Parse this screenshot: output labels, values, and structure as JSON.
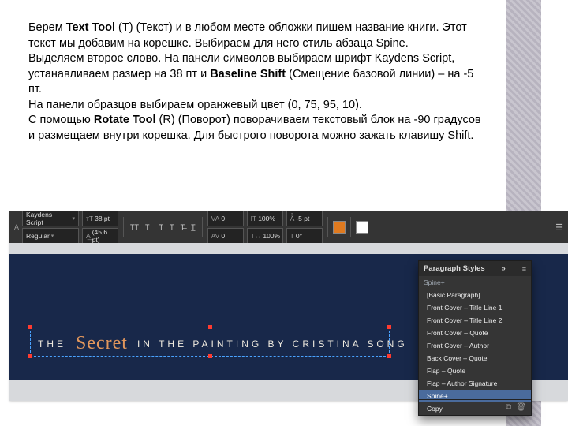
{
  "instruction": {
    "p1a": "Берем ",
    "p1b": "Text Tool",
    "p1c": " (T) (Текст) и в любом месте обложки пишем название книги. Этот текст мы добавим на корешке. Выбираем для него стиль абзаца Spine.",
    "p2a": "Выделяем второе слово. На панели символов выбираем шрифт Kaydens Script, устанавливаем размер на 38 пт и ",
    "p2b": "Baseline Shift",
    "p2c": " (Смещение базовой линии) – на -5 пт.",
    "p3": "На панели образцов выбираем оранжевый цвет (0, 75, 95, 10).",
    "p4a": "С помощью ",
    "p4b": "Rotate Tool",
    "p4c": " (R) (Поворот) поворачиваем текстовый блок на -90 градусов и размещаем внутри корешка. Для быстрого поворота можно зажать клавишу Shift."
  },
  "charbar": {
    "modeIcon": "A",
    "font": "Kaydens Script",
    "style": "Regular",
    "sizeIcon": "тТ",
    "size": "38 pt",
    "leadingIcon": "A͟",
    "leading": "(45,6 pt)",
    "caseBtns": [
      "TT",
      "Tт",
      "T",
      "Т",
      "T̶",
      "T̲"
    ],
    "kernIcon": "VA",
    "kern": "0",
    "trackIcon": "AV",
    "track": "0",
    "vscaleIcon": "IT",
    "vscale": "100%",
    "hscaleIcon": "T↔",
    "hscale": "100%",
    "baselineIcon": "Aͣ",
    "baseline": "-5 pt",
    "skewIcon": "T",
    "skew": "0°"
  },
  "title": {
    "t1": "THE ",
    "script": "Secret",
    "t2": " IN THE PAINTING BY CRISTINA SONG"
  },
  "pstyles": {
    "title": "Paragraph Styles",
    "current": "Spine+",
    "items": [
      "[Basic Paragraph]",
      "Front Cover – Title Line 1",
      "Front Cover – Title Line 2",
      "Front Cover – Quote",
      "Front Cover – Author",
      "Back Cover – Quote",
      "Flap – Quote",
      "Flap – Author Signature",
      "Spine+",
      "Copy"
    ],
    "selectedIndex": 8,
    "newIcon": "⧉",
    "trashIcon": "🗑"
  }
}
